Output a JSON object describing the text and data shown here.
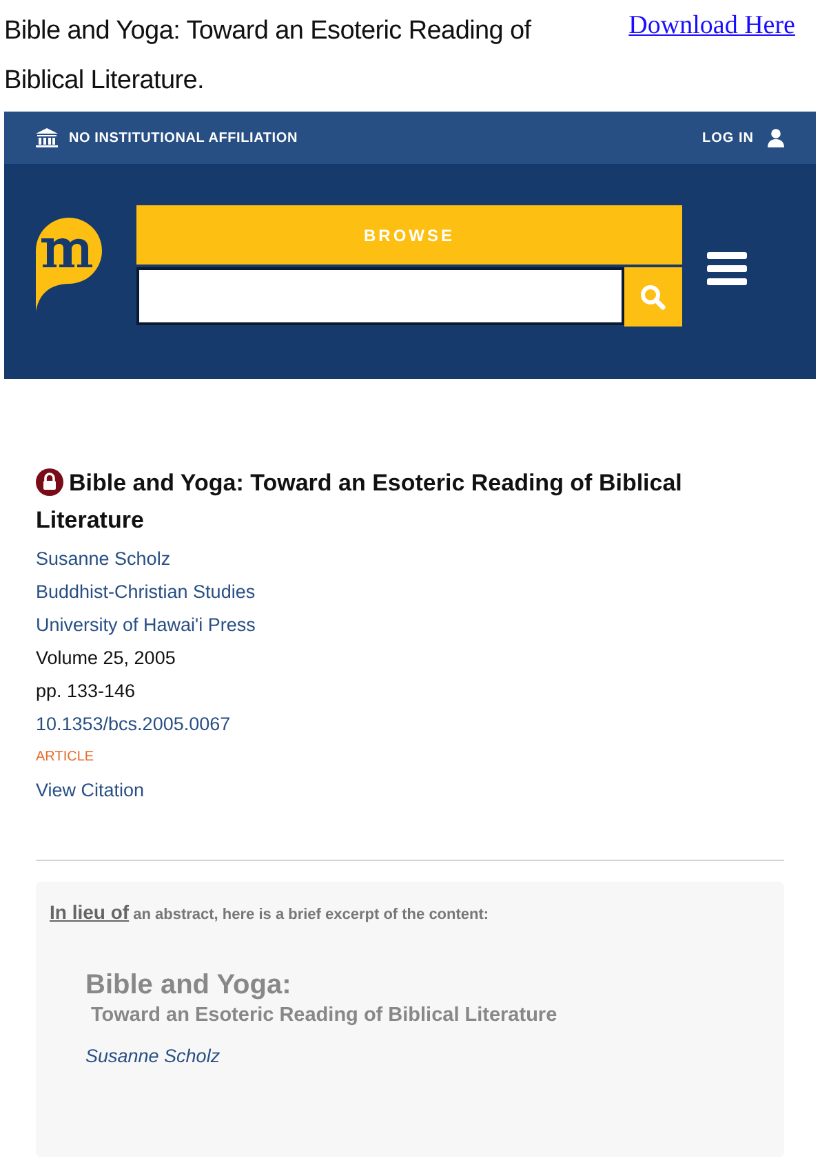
{
  "page_title": "Bible and Yoga: Toward an Esoteric Reading of Biblical Literature.",
  "download_link": "Download Here",
  "top_bar": {
    "affiliation": "NO INSTITUTIONAL AFFILIATION",
    "login": "LOG IN"
  },
  "header": {
    "browse": "BROWSE"
  },
  "article": {
    "title": "Bible and Yoga: Toward an Esoteric Reading of Biblical Literature",
    "locked": true,
    "meta": [
      {
        "kind": "link",
        "text": "Susanne Scholz"
      },
      {
        "kind": "link",
        "text": "Buddhist-Christian Studies"
      },
      {
        "kind": "link",
        "text": "University of Hawai'i Press"
      },
      {
        "kind": "text",
        "text": "Volume 25, 2005"
      },
      {
        "kind": "text",
        "text": "pp. 133-146"
      },
      {
        "kind": "link",
        "text": "10.1353/bcs.2005.0067"
      },
      {
        "kind": "tag",
        "text": "ARTICLE"
      },
      {
        "kind": "link",
        "text": "View Citation"
      }
    ]
  },
  "excerpt": {
    "intro_lead": "In lieu of",
    "intro_rest": "an abstract, here is a brief excerpt of the content:",
    "title": "Bible and Yoga:",
    "subtitle": "Toward an Esoteric Reading of Biblical Literature",
    "author": "Susanne Scholz"
  }
}
